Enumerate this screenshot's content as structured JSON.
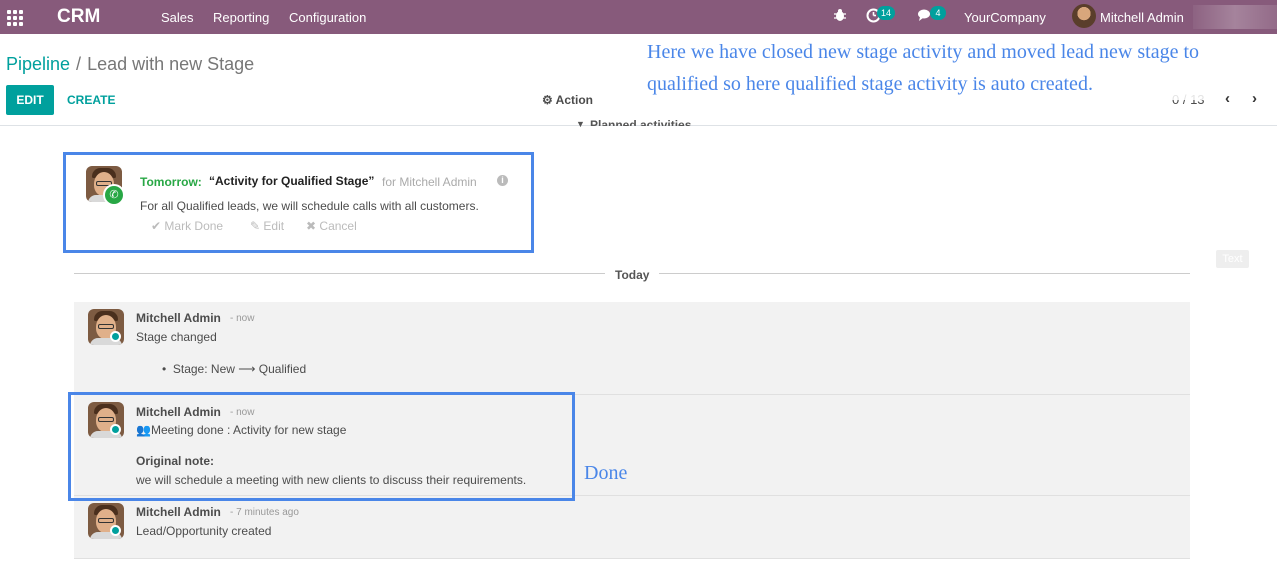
{
  "navbar": {
    "brand": "CRM",
    "menu": [
      "Sales",
      "Reporting",
      "Configuration"
    ],
    "activity_count": "14",
    "message_count": "4",
    "company": "YourCompany",
    "user": "Mitchell Admin"
  },
  "control_panel": {
    "breadcrumb_parent": "Pipeline",
    "breadcrumb_current": "Lead with new Stage",
    "edit_label": "EDIT",
    "create_label": "CREATE",
    "action_label": "Action",
    "pager": "0 / 13"
  },
  "annotations": {
    "top": "Here we have closed new stage activity and moved lead new stage to qualified so here qualified stage activity is auto created.",
    "done": "Done"
  },
  "planned_label": "Planned activities",
  "activity": {
    "when": "Tomorrow:",
    "title": "“Activity for Qualified Stage”",
    "for": "for Mitchell Admin",
    "note": "For all Qualified leads, we will schedule calls with all customers.",
    "mark_done": "Mark Done",
    "edit": "Edit",
    "cancel": "Cancel"
  },
  "text_chip": "Text",
  "separator": "Today",
  "messages": [
    {
      "author": "Mitchell Admin",
      "time": "- now",
      "line1": "Stage changed",
      "bullet": "Stage: New ⟶ Qualified"
    },
    {
      "author": "Mitchell Admin",
      "time": "- now",
      "line1": "Meeting done : Activity for new stage",
      "note_label": "Original note:",
      "note": "we will schedule a meeting with new clients to discuss their requirements."
    },
    {
      "author": "Mitchell Admin",
      "time": "- 7 minutes ago",
      "line1": "Lead/Opportunity created"
    }
  ],
  "colors": {
    "navbar": "#875a7b",
    "primary": "#00a09d",
    "annotation": "#4a86e8",
    "activity_green": "#28a745"
  }
}
